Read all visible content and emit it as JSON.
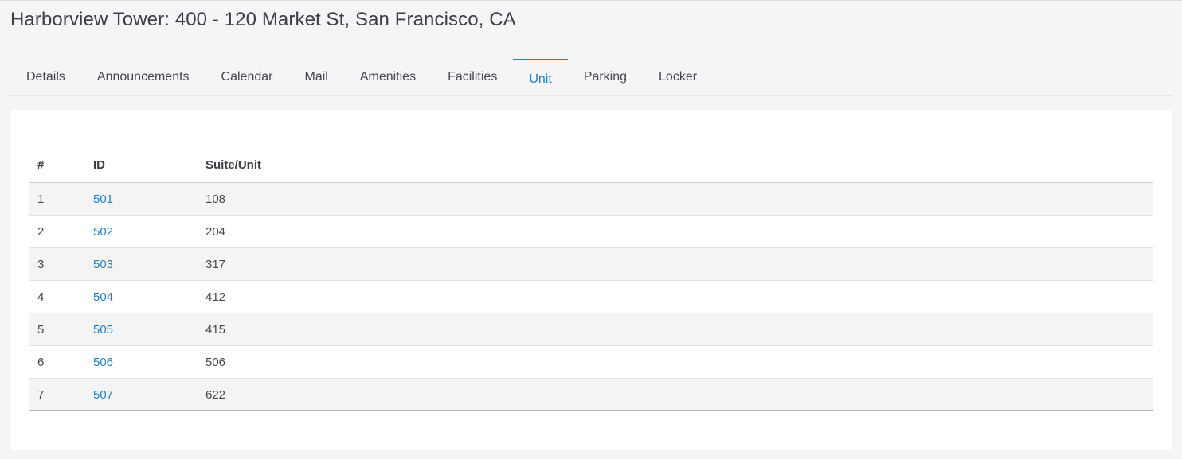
{
  "header": {
    "title": "Harborview Tower: 400 - 120 Market St, San Francisco, CA"
  },
  "tabs": [
    {
      "label": "Details",
      "active": false
    },
    {
      "label": "Announcements",
      "active": false
    },
    {
      "label": "Calendar",
      "active": false
    },
    {
      "label": "Mail",
      "active": false
    },
    {
      "label": "Amenities",
      "active": false
    },
    {
      "label": "Facilities",
      "active": false
    },
    {
      "label": "Unit",
      "active": true
    },
    {
      "label": "Parking",
      "active": false
    },
    {
      "label": "Locker",
      "active": false
    }
  ],
  "table": {
    "columns": [
      "#",
      "ID",
      "Suite/Unit"
    ],
    "rows": [
      {
        "num": "1",
        "id": "501",
        "suite": "108"
      },
      {
        "num": "2",
        "id": "502",
        "suite": "204"
      },
      {
        "num": "3",
        "id": "503",
        "suite": "317"
      },
      {
        "num": "4",
        "id": "504",
        "suite": "412"
      },
      {
        "num": "5",
        "id": "505",
        "suite": "415"
      },
      {
        "num": "6",
        "id": "506",
        "suite": "506"
      },
      {
        "num": "7",
        "id": "507",
        "suite": "622"
      }
    ]
  },
  "colors": {
    "accent": "#2a7fc1",
    "background": "#f4f5f7",
    "card": "#ffffff",
    "row_stripe": "#f4f4f5"
  }
}
